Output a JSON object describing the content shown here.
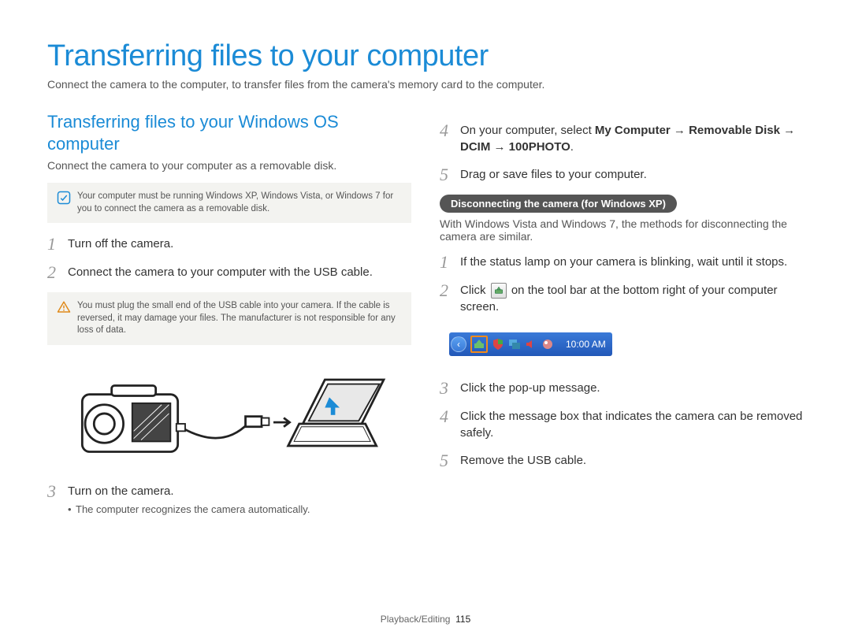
{
  "title": "Transferring files to your computer",
  "desc": "Connect the camera to the computer, to transfer files from the camera's memory card to the computer.",
  "section1": {
    "title": "Transferring files to your Windows OS computer",
    "desc": "Connect the camera to your computer as a removable disk.",
    "note1": "Your computer must be running Windows XP, Windows Vista, or Windows 7 for you to connect the camera as a removable disk.",
    "step1": "Turn off the camera.",
    "step2": "Connect the camera to your computer with the USB cable.",
    "note2": "You must plug the small end of the USB cable into your camera. If the cable is reversed, it may damage your files. The manufacturer is not responsible for any loss of data.",
    "step3": "Turn on the camera.",
    "step3_sub": "The computer recognizes the camera automatically."
  },
  "section2": {
    "step4_pre": "On your computer, select ",
    "step4_path": "My Computer → Removable Disk → DCIM → 100PHOTO",
    "step5": "Drag or save files to your computer."
  },
  "disconnect": {
    "pill": "Disconnecting the camera (for Windows XP)",
    "desc": "With Windows Vista and Windows 7, the methods for disconnecting the camera are similar.",
    "step1": "If the status lamp on your camera is blinking, wait until it stops.",
    "step2_a": "Click ",
    "step2_b": " on the tool bar at the bottom right of your computer screen.",
    "step3": "Click the pop-up message.",
    "step4": "Click the message box that indicates the camera can be removed safely.",
    "step5": "Remove the USB cable."
  },
  "taskbar_time": "10:00 AM",
  "footer_section": "Playback/Editing",
  "footer_page": "115"
}
